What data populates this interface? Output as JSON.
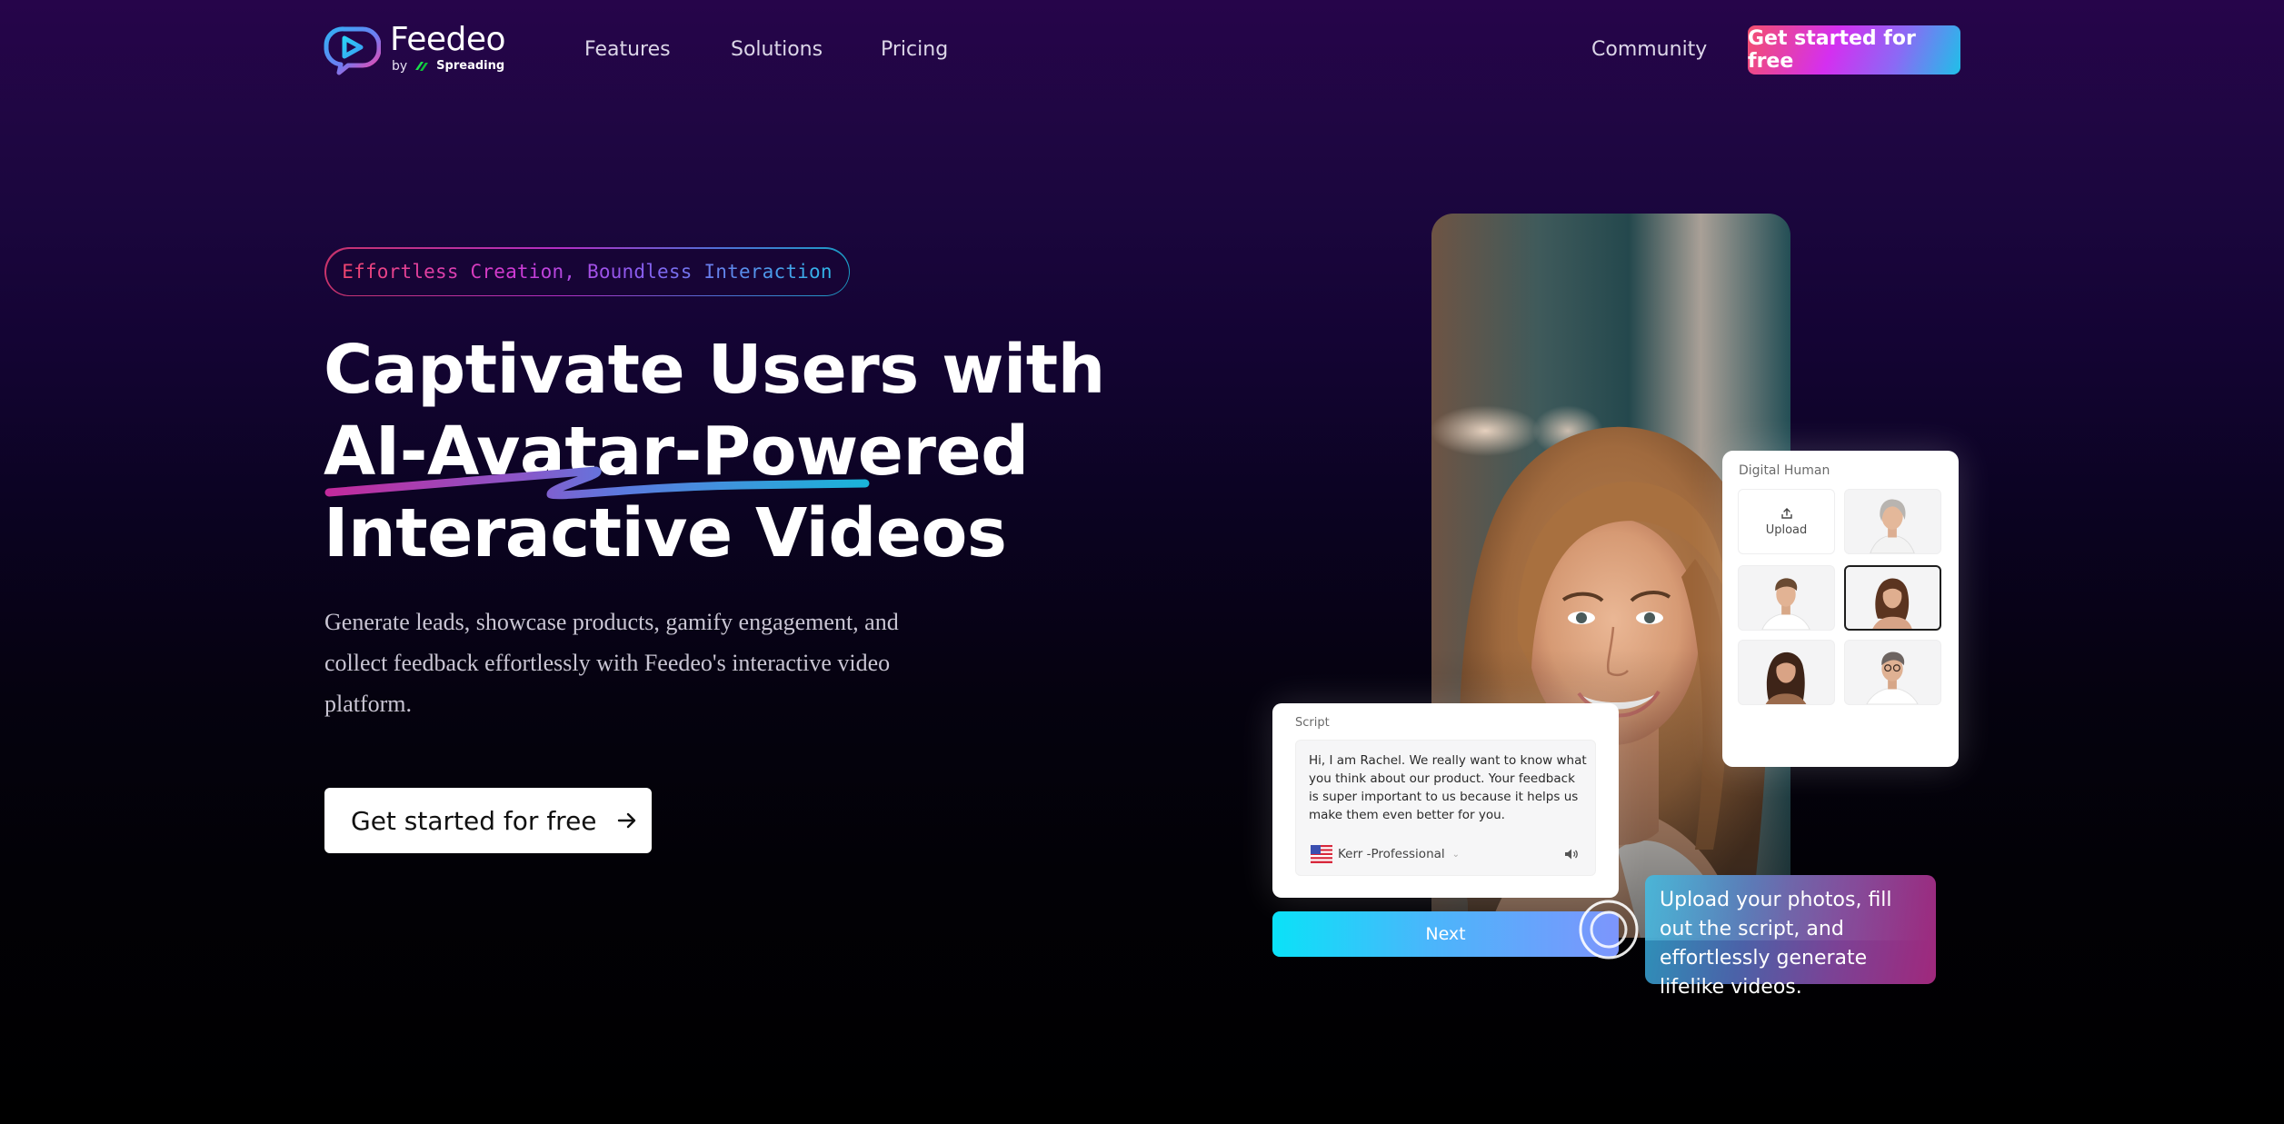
{
  "brand": {
    "name": "Feedeo",
    "by_label": "by",
    "parent_brand": "Spreading"
  },
  "nav": {
    "links": [
      {
        "label": "Features"
      },
      {
        "label": "Solutions"
      },
      {
        "label": "Pricing"
      }
    ],
    "community_label": "Community",
    "cta_label": "Get started for free"
  },
  "hero": {
    "tagline": "Effortless Creation, Boundless Interaction",
    "title_lines": [
      "Captivate Users with",
      "AI-Avatar-Powered",
      "Interactive Videos"
    ],
    "description": "Generate leads, showcase products, gamify engagement, and collect feedback effortlessly with Feedeo's interactive video platform.",
    "cta_label": "Get started for free",
    "cta_icon": "arrow-right-icon"
  },
  "demo": {
    "digital_human": {
      "title": "Digital Human",
      "upload_label": "Upload",
      "avatars": [
        {
          "name": "older-woman",
          "selected": false
        },
        {
          "name": "young-man",
          "selected": false
        },
        {
          "name": "brunette-woman",
          "selected": true
        },
        {
          "name": "long-hair-woman",
          "selected": false
        },
        {
          "name": "man-with-glasses",
          "selected": false
        }
      ]
    },
    "script": {
      "label": "Script",
      "text": "Hi, I am Rachel. We really want to know what you think about our product. Your feedback is super important to us because it helps us make them even better for you.",
      "voice": "Kerr -Professional",
      "voice_flag": "us-flag-icon",
      "speaker_icon": "speaker-icon"
    },
    "next_label": "Next",
    "callout_text": "Upload your photos, fill out the script, and effortlessly generate lifelike videos."
  },
  "colors": {
    "cta_gradient": [
      "#f4506c",
      "#d42ff0",
      "#8a6af5",
      "#1fc0e8"
    ],
    "next_gradient": [
      "#0ae2f8",
      "#7d95fc"
    ],
    "callout_gradient": [
      "#2e9cc4",
      "#a0287c"
    ],
    "background_top": "#26054a",
    "background_bottom": "#000000"
  }
}
